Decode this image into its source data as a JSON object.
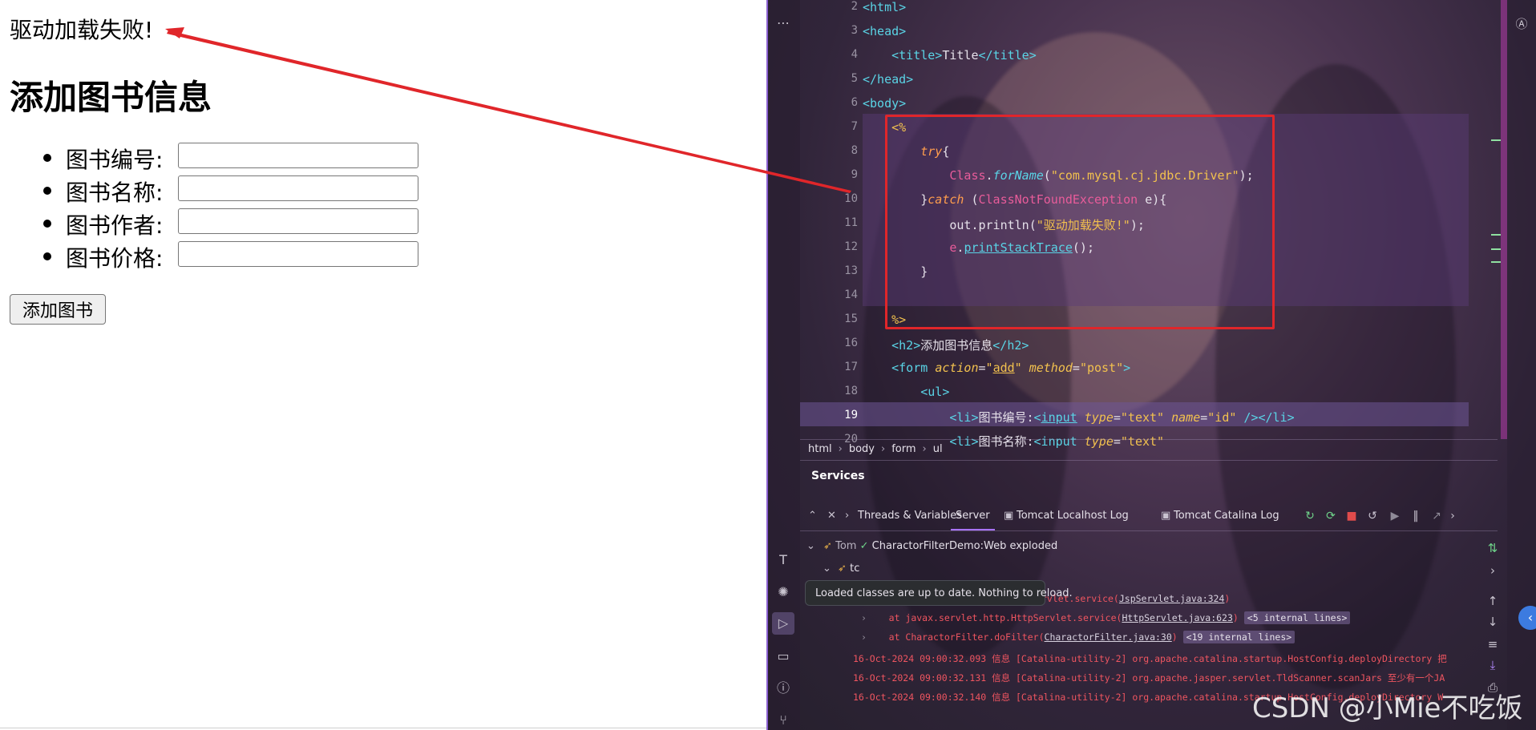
{
  "browser": {
    "message": "驱动加载失败!",
    "heading": "添加图书信息",
    "fields": [
      {
        "label": "图书编号:"
      },
      {
        "label": "图书名称:"
      },
      {
        "label": "图书作者:"
      },
      {
        "label": "图书价格:"
      }
    ],
    "submit_label": "添加图书"
  },
  "ide": {
    "line_numbers": [
      "2",
      "3",
      "4",
      "5",
      "6",
      "7",
      "8",
      "9",
      "10",
      "11",
      "12",
      "13",
      "14",
      "15",
      "16",
      "17",
      "18",
      "19",
      "20"
    ],
    "current_line": "19",
    "breadcrumb": [
      "html",
      "body",
      "form",
      "ul"
    ],
    "services_title": "Services",
    "tabs": [
      "Threads & Variables",
      "Server",
      "Tomcat Localhost Log",
      "Tomcat Catalina Log"
    ],
    "active_tab": "Server",
    "tree": {
      "root_label": "Tom",
      "artifact": "CharactorFilterDemo:Web exploded",
      "child": "tc"
    },
    "tooltip": "Loaded classes are up to date. Nothing to reload.",
    "log_lines": [
      {
        "prefix": "ervlet.service(",
        "link": "JspServlet.java:324",
        "suffix": ")"
      },
      {
        "prefix": "at javax.servlet.http.HttpServlet.service(",
        "link": "HttpServlet.java:623",
        "suffix": ")",
        "chip": "<5 internal lines>"
      },
      {
        "prefix": "at CharactorFilter.doFilter(",
        "link": "CharactorFilter.java:30",
        "suffix": ")",
        "chip": "<19 internal lines>"
      },
      {
        "text": "16-Oct-2024 09:00:32.093 信息 [Catalina-utility-2] org.apache.catalina.startup.HostConfig.deployDirectory 把"
      },
      {
        "text": "16-Oct-2024 09:00:32.131 信息 [Catalina-utility-2] org.apache.jasper.servlet.TldScanner.scanJars 至少有一个JA"
      },
      {
        "text": "16-Oct-2024 09:00:32.140 信息 [Catalina-utility-2] org.apache.catalina.startup.HostConfig.deployDirectory W"
      }
    ],
    "watermark": "CSDN @小Mie不吃饭",
    "colors": {
      "error_red": "#e0262a",
      "accent_purple": "#a873ff"
    }
  }
}
